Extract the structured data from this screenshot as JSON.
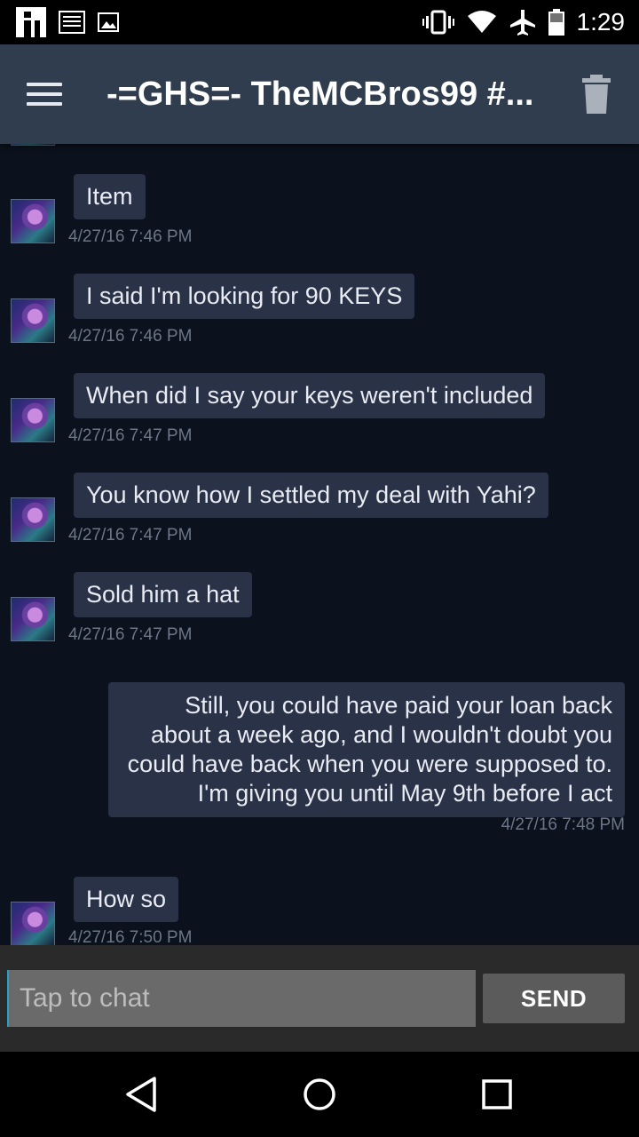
{
  "status_bar": {
    "time": "1:29",
    "left_icons": [
      "app-notification-icon",
      "news-notification-icon",
      "image-notification-icon"
    ],
    "right_icons": [
      "vibrate-icon",
      "wifi-icon",
      "airplane-icon",
      "battery-icon"
    ]
  },
  "app_bar": {
    "title": "-=GHS=- TheMCBros99 #...",
    "menu_icon": "hamburger-menu-icon",
    "action_icon": "trash-icon"
  },
  "messages": [
    {
      "text": "Item",
      "timestamp": "4/27/16 7:46 PM",
      "mine": false
    },
    {
      "text": "I said I'm looking for 90 KEYS",
      "timestamp": "4/27/16 7:46 PM",
      "mine": false
    },
    {
      "text": "When did I say your keys weren't included",
      "timestamp": "4/27/16 7:47 PM",
      "mine": false
    },
    {
      "text": "You know how I settled my deal with Yahi?",
      "timestamp": "4/27/16 7:47 PM",
      "mine": false
    },
    {
      "text": "Sold him a hat",
      "timestamp": "4/27/16 7:47 PM",
      "mine": false
    },
    {
      "text": "Still, you could have paid your loan back about a week ago, and I wouldn't doubt you could have back when you were supposed to. I'm giving you until May 9th before I act",
      "timestamp": "4/27/16 7:48 PM",
      "mine": true
    },
    {
      "text": "How so",
      "timestamp": "4/27/16 7:50 PM",
      "mine": false
    }
  ],
  "input": {
    "placeholder": "Tap to chat",
    "value": ""
  },
  "send_button": {
    "label": "SEND"
  },
  "nav_bar": {
    "icons": [
      "back-icon",
      "home-icon",
      "recents-icon"
    ]
  },
  "colors": {
    "app_bar": "#2f3d4f",
    "background": "#0b121d",
    "bubble": "#2a3248",
    "timestamp": "#6c7686",
    "input_bar": "#2a2a2a"
  }
}
